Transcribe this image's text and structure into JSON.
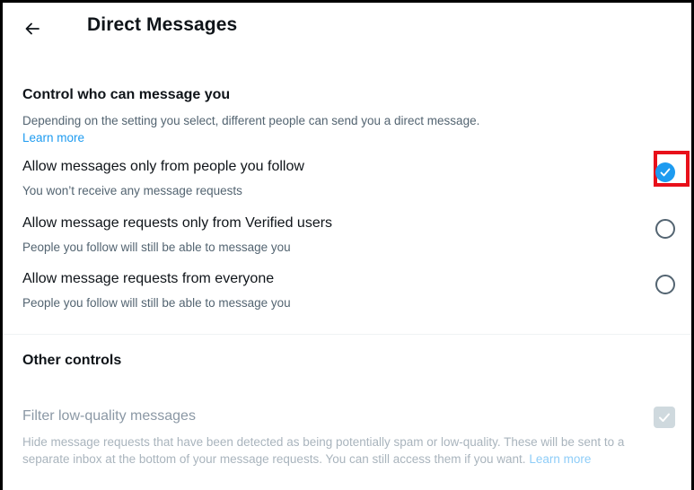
{
  "header": {
    "title": "Direct Messages",
    "back_icon": "arrow-left-icon"
  },
  "control_section": {
    "title": "Control who can message you",
    "description": "Depending on the setting you select, different people can send you a direct message.",
    "learn_more": "Learn more"
  },
  "options": [
    {
      "label": "Allow messages only from people you follow",
      "sub": "You won’t receive any message requests",
      "selected": true
    },
    {
      "label": "Allow message requests only from Verified users",
      "sub": "People you follow will still be able to message you",
      "selected": false
    },
    {
      "label": "Allow message requests from everyone",
      "sub": "People you follow will still be able to message you",
      "selected": false
    }
  ],
  "other_section": {
    "title": "Other controls",
    "filter_label": "Filter low-quality messages",
    "filter_description": "Hide message requests that have been detected as being potentially spam or low-quality. These will be sent to a separate inbox at the bottom of your message requests. You can still access them if you want.",
    "filter_learn_more": "Learn more",
    "filter_checked": true,
    "filter_disabled": true
  },
  "colors": {
    "accent": "#1d9bf0",
    "highlight": "#e8101a",
    "text": "#0f1419",
    "secondary": "#536471"
  }
}
